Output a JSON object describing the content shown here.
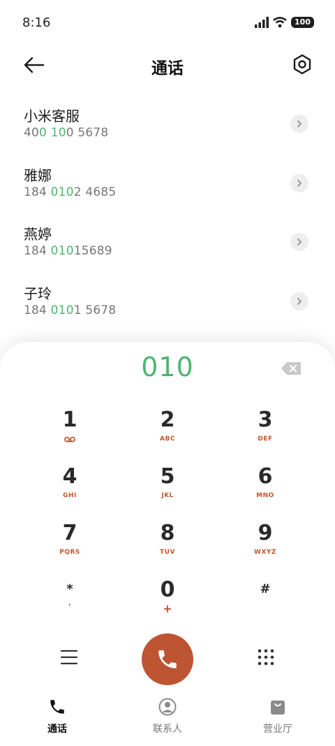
{
  "status": {
    "time": "8:16",
    "battery": "100"
  },
  "header": {
    "title": "通话"
  },
  "results": [
    {
      "name": "小米客服",
      "num_pre1": "40",
      "num_hl1": "0",
      "num_mid": " ",
      "num_hl2": "10",
      "num_post": "0 5678"
    },
    {
      "name": "雅娜",
      "num_pre1": "184 ",
      "num_hl1": "010",
      "num_mid": "",
      "num_hl2": "",
      "num_post": "2 4685"
    },
    {
      "name": "燕婷",
      "num_pre1": "184 ",
      "num_hl1": "010",
      "num_mid": "",
      "num_hl2": "",
      "num_post": "15689"
    },
    {
      "name": "子玲",
      "num_pre1": "184 ",
      "num_hl1": "010",
      "num_mid": "",
      "num_hl2": "",
      "num_post": "1 5678"
    }
  ],
  "dialer": {
    "typed": "010",
    "keys": [
      {
        "digit": "1",
        "letters": ""
      },
      {
        "digit": "2",
        "letters": "ABC"
      },
      {
        "digit": "3",
        "letters": "DEF"
      },
      {
        "digit": "4",
        "letters": "GHI"
      },
      {
        "digit": "5",
        "letters": "JKL"
      },
      {
        "digit": "6",
        "letters": "MNO"
      },
      {
        "digit": "7",
        "letters": "PQRS"
      },
      {
        "digit": "8",
        "letters": "TUV"
      },
      {
        "digit": "9",
        "letters": "WXYZ"
      },
      {
        "digit": "*",
        "letters": ","
      },
      {
        "digit": "0",
        "letters": "+"
      },
      {
        "digit": "#",
        "letters": ""
      }
    ]
  },
  "tabs": [
    {
      "label": "通话",
      "icon": "phone-icon",
      "active": true
    },
    {
      "label": "联系人",
      "icon": "contacts-icon",
      "active": false
    },
    {
      "label": "营业厅",
      "icon": "shopping-bag-icon",
      "active": false
    }
  ],
  "colors": {
    "accent_green": "#4fb46f",
    "accent_orange": "#c4562d",
    "call_button": "#bd5532"
  }
}
